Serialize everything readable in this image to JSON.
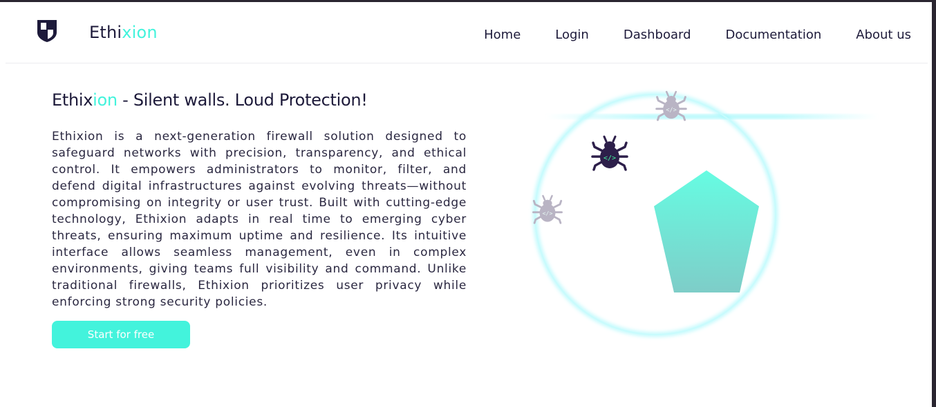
{
  "brand": {
    "name_prefix": "Ethi",
    "name_accent": "xion"
  },
  "nav": {
    "items": [
      "Home",
      "Login",
      "Dashboard",
      "Documentation",
      "About us"
    ]
  },
  "hero": {
    "title_prefix": "Ethix",
    "title_accent": "ion",
    "title_suffix": " - Silent walls. Loud Protection!",
    "description": "Ethixion is a next-generation firewall solution designed to safeguard networks with precision, transparency, and ethical control. It empowers administrators to monitor, filter, and defend digital infrastructures against evolving threats—without compromising on integrity or user trust. Built with cutting-edge technology, Ethixion adapts in real time to emerging cyber threats, ensuring maximum uptime and resilience. Its intuitive interface allows seamless management, even in complex environments, giving teams full visibility and command. Unlike traditional firewalls, Ethixion prioritizes user privacy while enforcing strong security policies.",
    "cta_label": "Start for free"
  },
  "illustration": {
    "icons": [
      "bug-icon",
      "shield-pentagon"
    ]
  },
  "colors": {
    "accent": "#43f3dc",
    "text": "#1d1a3a",
    "bug_dark": "#2d1f4a",
    "bug_light": "#b9b4c4",
    "circle": "#9ff7fb"
  }
}
